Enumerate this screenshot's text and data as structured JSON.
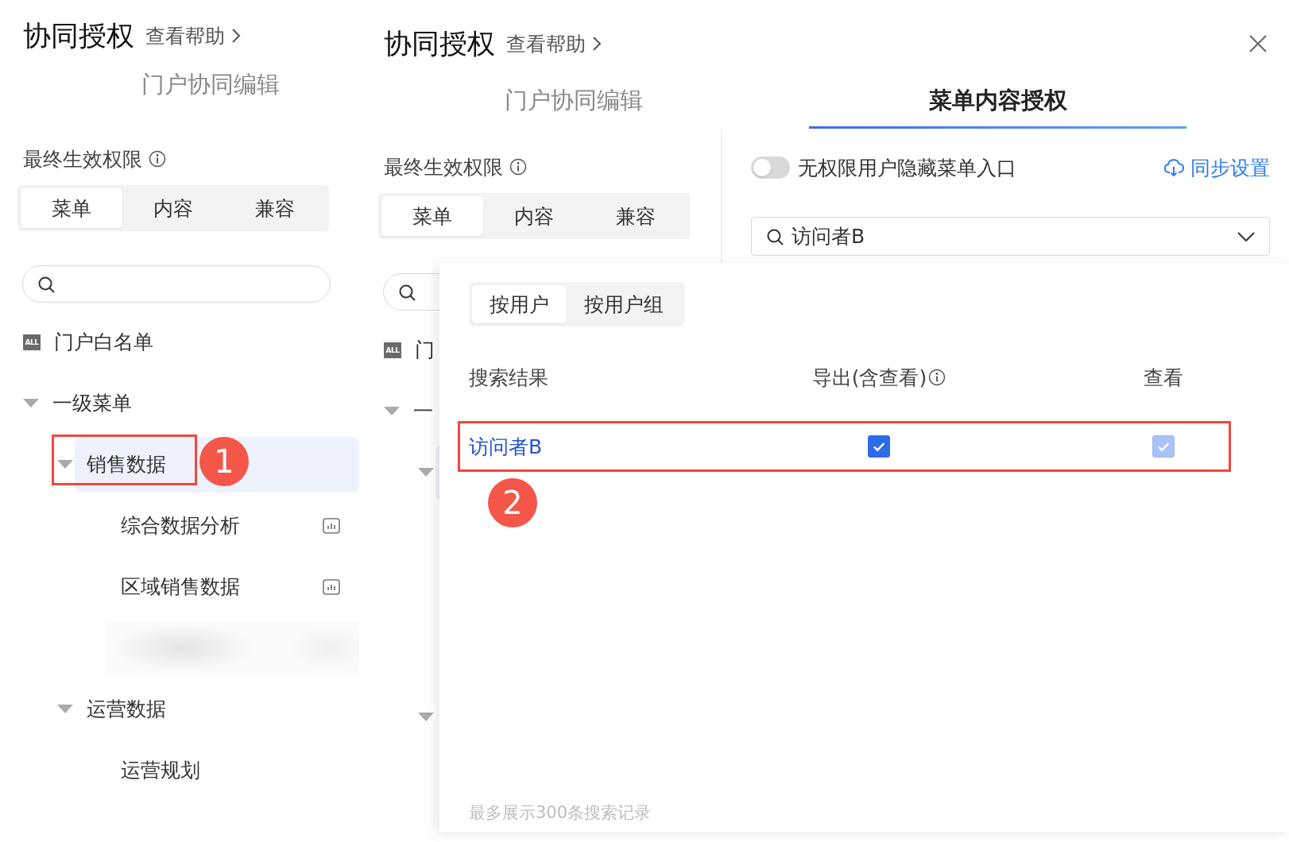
{
  "background_panel": {
    "title": "协同授权",
    "help_link": "查看帮助",
    "tab": {
      "label": "门户协同编辑",
      "selected": false
    },
    "column": {
      "permission_label": "最终生效权限",
      "segments": [
        {
          "label": "菜单",
          "selected": true
        },
        {
          "label": "内容",
          "selected": false
        },
        {
          "label": "兼容",
          "selected": false
        }
      ],
      "tree": [
        {
          "kind": "all",
          "badge": "ALL",
          "label": "门户白名单",
          "selected": false
        },
        {
          "kind": "folder",
          "label": "一级菜单",
          "expanded": true,
          "selected": false,
          "children": [
            {
              "kind": "folder",
              "label": "销售数据",
              "expanded": true,
              "selected": true,
              "children": [
                {
                  "kind": "report",
                  "label": "综合数据分析",
                  "selected": false
                },
                {
                  "kind": "report",
                  "label": "区域销售数据",
                  "selected": false
                },
                {
                  "kind": "blurred"
                }
              ]
            },
            {
              "kind": "folder",
              "label": "运营数据",
              "expanded": true,
              "selected": false,
              "children": [
                {
                  "kind": "page",
                  "label": "运营规划",
                  "selected": false
                }
              ]
            }
          ]
        }
      ]
    }
  },
  "dialog": {
    "title": "协同授权",
    "help_link": "查看帮助",
    "tabs": [
      {
        "label": "门户协同编辑",
        "selected": false
      },
      {
        "label": "菜单内容授权",
        "selected": true
      }
    ],
    "column": {
      "permission_label": "最终生效权限",
      "segments": [
        {
          "label": "菜单",
          "selected": true
        },
        {
          "label": "内容",
          "selected": false
        },
        {
          "label": "兼容",
          "selected": false
        }
      ],
      "tree": [
        {
          "kind": "all",
          "badge": "ALL",
          "label": "门",
          "selected": false
        },
        {
          "kind": "folder",
          "label": "一",
          "expanded": true,
          "selected": false,
          "children": [
            {
              "kind": "folder",
              "expanded": true,
              "selected": true,
              "children": [
                {
                  "kind": "covered"
                },
                {
                  "kind": "covered"
                },
                {
                  "kind": "covered"
                }
              ]
            },
            {
              "kind": "folder",
              "expanded": true,
              "selected": false
            }
          ]
        }
      ]
    },
    "hide_menu": {
      "label": "无权限用户隐藏菜单入口",
      "on": false
    },
    "sync_button": "同步设置",
    "user_select": {
      "value": "访问者B"
    },
    "popup": {
      "segments": [
        {
          "label": "按用户",
          "selected": true
        },
        {
          "label": "按用户组",
          "selected": false
        }
      ],
      "columns": [
        {
          "label": "搜索结果",
          "info": false
        },
        {
          "label": "导出(含查看)",
          "info": true
        },
        {
          "label": "查看",
          "info": false
        }
      ],
      "rows": [
        {
          "name": "访问者B",
          "export": {
            "checked": true,
            "disabled": false
          },
          "view": {
            "checked": true,
            "disabled": true
          }
        }
      ],
      "footer": "最多展示300条搜索记录"
    }
  },
  "annotations": [
    {
      "label": "1"
    },
    {
      "label": "2"
    }
  ]
}
